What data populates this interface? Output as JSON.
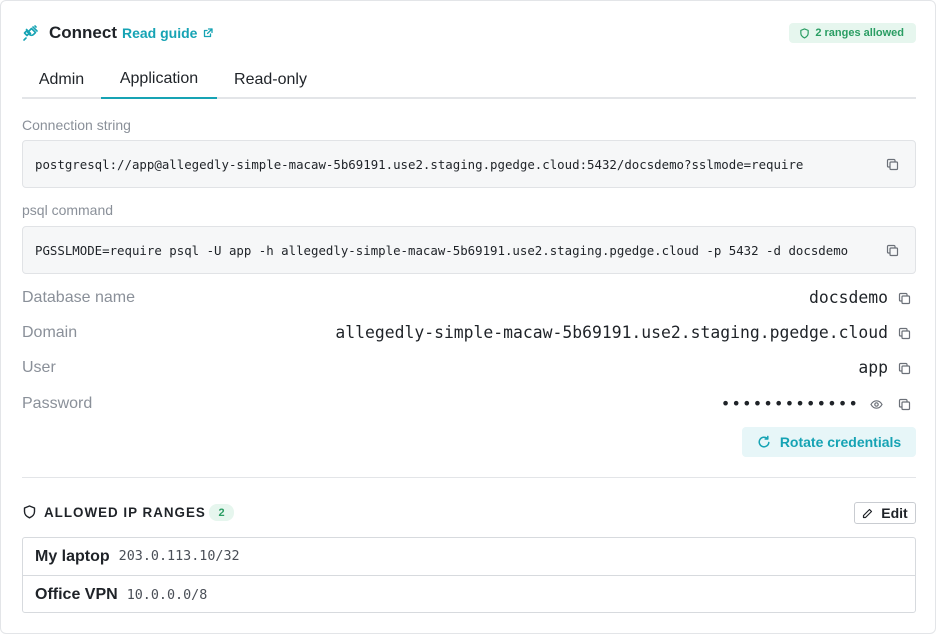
{
  "header": {
    "title": "Connect",
    "guide_link": "Read guide",
    "ranges_badge": "2 ranges allowed",
    "icon": "plug-icon"
  },
  "tabs": [
    {
      "label": "Admin",
      "active": false
    },
    {
      "label": "Application",
      "active": true
    },
    {
      "label": "Read-only",
      "active": false
    }
  ],
  "connection_string": {
    "label": "Connection string",
    "value": "postgresql://app@allegedly-simple-macaw-5b69191.use2.staging.pgedge.cloud:5432/docsdemo?sslmode=require"
  },
  "psql_command": {
    "label": "psql command",
    "value": "PGSSLMODE=require psql -U app -h allegedly-simple-macaw-5b69191.use2.staging.pgedge.cloud -p 5432 -d docsdemo"
  },
  "fields": {
    "database_name": {
      "label": "Database name",
      "value": "docsdemo"
    },
    "domain": {
      "label": "Domain",
      "value": "allegedly-simple-macaw-5b69191.use2.staging.pgedge.cloud"
    },
    "user": {
      "label": "User",
      "value": "app"
    },
    "password": {
      "label": "Password",
      "value": "•••••••••••••"
    }
  },
  "rotate_button": "Rotate credentials",
  "allowed_ip": {
    "title": "ALLOWED IP RANGES",
    "count": "2",
    "edit_label": "Edit",
    "ranges": [
      {
        "name": "My laptop",
        "cidr": "203.0.113.10/32"
      },
      {
        "name": "Office VPN",
        "cidr": "10.0.0.0/8"
      }
    ]
  },
  "colors": {
    "accent": "#16a3b4",
    "success": "#2a9d63",
    "success_bg": "#e6f6ee",
    "muted_text": "#8a9099"
  }
}
